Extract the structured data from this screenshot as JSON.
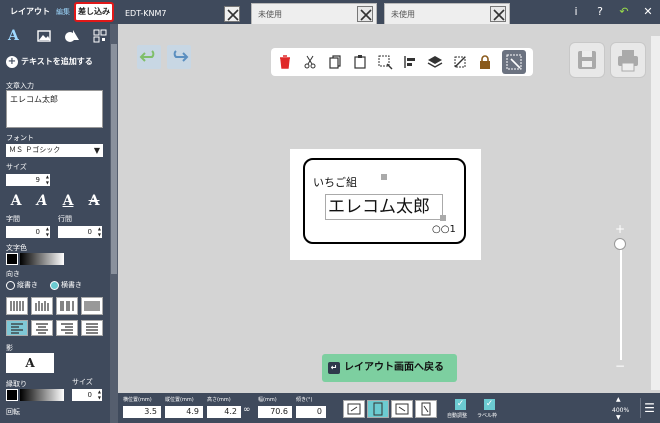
{
  "mode_tabs": {
    "layout": "レイアウト",
    "edit": "編集",
    "merge": "差し込み"
  },
  "doc_tabs": [
    {
      "label": "EDT-KNM7",
      "active": true
    },
    {
      "label": "未使用",
      "active": false
    },
    {
      "label": "未使用",
      "active": false
    }
  ],
  "header_icons": [
    "info-icon",
    "help-icon",
    "undo-icon",
    "close-icon"
  ],
  "header_glyphs": {
    "info": "i",
    "help": "?",
    "undo": "↶",
    "close": "✕"
  },
  "sidebar": {
    "add_text": "テキストを追加する",
    "text_input_label": "文章入力",
    "text_input_value": "エレコム太郎",
    "font_label": "フォント",
    "font_value": "ＭＳ Ｐゴシック",
    "size_label": "サイズ",
    "size_value": "9",
    "char_spacing_label": "字間",
    "char_spacing_value": "0",
    "line_spacing_label": "行間",
    "line_spacing_value": "0",
    "text_color_label": "文字色",
    "direction_label": "向き",
    "vertical_label": "縦書き",
    "horizontal_label": "横書き",
    "shadow_label": "影",
    "border_label": "縁取り",
    "border_size_label": "サイズ",
    "border_size_value": "0",
    "rotation_label": "回転",
    "style_glyph": "A",
    "shadow_glyph": "A"
  },
  "label": {
    "small_text": "いちご組",
    "name_text": "エレコム太郎",
    "circles_text": "○○1"
  },
  "back_button": "レイアウト画面へ戻る",
  "bottom": {
    "h_pos_label": "横位置(mm)",
    "h_pos_value": "3.5",
    "v_pos_label": "縦位置(mm)",
    "v_pos_value": "4.9",
    "height_label": "高さ(mm)",
    "height_value": "4.2",
    "width_label": "幅(mm)",
    "width_value": "70.6",
    "tilt_label": "傾き(°)",
    "tilt_value": "0",
    "check1_label": "自動調整",
    "check2_label": "ラベル枠",
    "zoom_text": "400%"
  }
}
